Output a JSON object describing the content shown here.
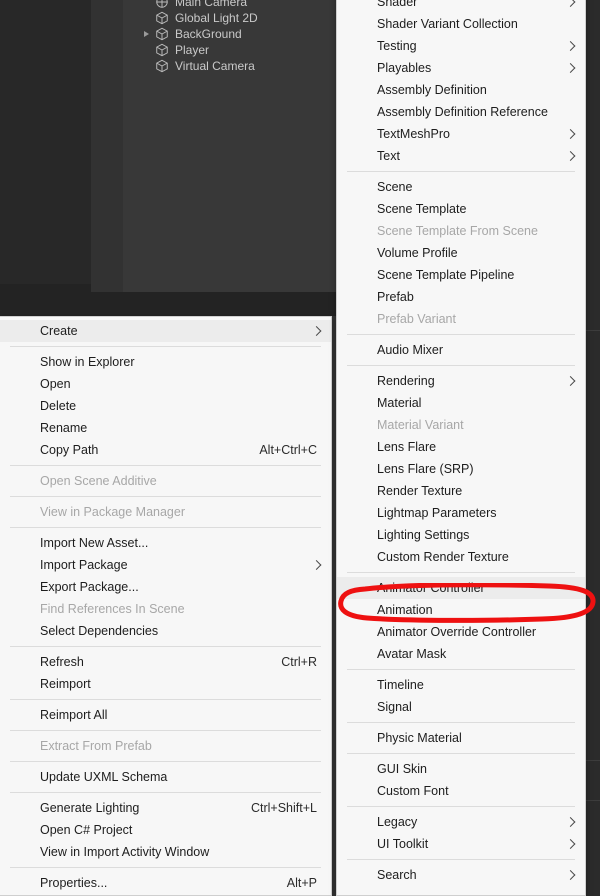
{
  "colors": {
    "annotation": "#ee1111",
    "menu_bg": "#f7f7f7",
    "menu_highlight": "#ececec",
    "editor_bg": "#383838",
    "disabled_text": "#a7a7a7"
  },
  "hierarchy": {
    "items": [
      {
        "label": "Main Camera",
        "icon": "camera-icon",
        "expandable": false,
        "partially_cut_off": true
      },
      {
        "label": "Global Light 2D",
        "icon": "prefab-cube-icon",
        "expandable": false
      },
      {
        "label": "BackGround",
        "icon": "prefab-cube-icon",
        "expandable": true
      },
      {
        "label": "Player",
        "icon": "prefab-cube-icon",
        "expandable": false
      },
      {
        "label": "Virtual Camera",
        "icon": "prefab-cube-icon",
        "expandable": false
      }
    ]
  },
  "context_menu": {
    "name": "project-window-context-menu",
    "items": [
      {
        "label": "Create",
        "submenu": true,
        "highlighted": true
      },
      {
        "separator": true
      },
      {
        "label": "Show in Explorer"
      },
      {
        "label": "Open"
      },
      {
        "label": "Delete"
      },
      {
        "label": "Rename"
      },
      {
        "label": "Copy Path",
        "shortcut": "Alt+Ctrl+C"
      },
      {
        "separator": true
      },
      {
        "label": "Open Scene Additive",
        "disabled": true
      },
      {
        "separator": true
      },
      {
        "label": "View in Package Manager",
        "disabled": true
      },
      {
        "separator": true
      },
      {
        "label": "Import New Asset..."
      },
      {
        "label": "Import Package",
        "submenu": true
      },
      {
        "label": "Export Package..."
      },
      {
        "label": "Find References In Scene",
        "disabled": true
      },
      {
        "label": "Select Dependencies"
      },
      {
        "separator": true
      },
      {
        "label": "Refresh",
        "shortcut": "Ctrl+R"
      },
      {
        "label": "Reimport"
      },
      {
        "separator": true
      },
      {
        "label": "Reimport All"
      },
      {
        "separator": true
      },
      {
        "label": "Extract From Prefab",
        "disabled": true
      },
      {
        "separator": true
      },
      {
        "label": "Update UXML Schema"
      },
      {
        "separator": true
      },
      {
        "label": "Generate Lighting",
        "shortcut": "Ctrl+Shift+L"
      },
      {
        "label": "Open C# Project"
      },
      {
        "label": "View in Import Activity Window"
      },
      {
        "separator": true
      },
      {
        "label": "Properties...",
        "shortcut": "Alt+P"
      }
    ]
  },
  "create_submenu": {
    "name": "create-submenu",
    "items": [
      {
        "label": "Shader",
        "submenu": true
      },
      {
        "label": "Shader Variant Collection"
      },
      {
        "label": "Testing",
        "submenu": true
      },
      {
        "label": "Playables",
        "submenu": true
      },
      {
        "label": "Assembly Definition"
      },
      {
        "label": "Assembly Definition Reference"
      },
      {
        "label": "TextMeshPro",
        "submenu": true
      },
      {
        "label": "Text",
        "submenu": true
      },
      {
        "separator": true
      },
      {
        "label": "Scene"
      },
      {
        "label": "Scene Template"
      },
      {
        "label": "Scene Template From Scene",
        "disabled": true
      },
      {
        "label": "Volume Profile"
      },
      {
        "label": "Scene Template Pipeline"
      },
      {
        "label": "Prefab"
      },
      {
        "label": "Prefab Variant",
        "disabled": true
      },
      {
        "separator": true
      },
      {
        "label": "Audio Mixer"
      },
      {
        "separator": true
      },
      {
        "label": "Rendering",
        "submenu": true
      },
      {
        "label": "Material"
      },
      {
        "label": "Material Variant",
        "disabled": true
      },
      {
        "label": "Lens Flare"
      },
      {
        "label": "Lens Flare (SRP)"
      },
      {
        "label": "Render Texture"
      },
      {
        "label": "Lightmap Parameters"
      },
      {
        "label": "Lighting Settings"
      },
      {
        "label": "Custom Render Texture"
      },
      {
        "separator": true
      },
      {
        "label": "Animator Controller",
        "highlighted": true,
        "annotated": true
      },
      {
        "label": "Animation"
      },
      {
        "label": "Animator Override Controller"
      },
      {
        "label": "Avatar Mask"
      },
      {
        "separator": true
      },
      {
        "label": "Timeline"
      },
      {
        "label": "Signal"
      },
      {
        "separator": true
      },
      {
        "label": "Physic Material"
      },
      {
        "separator": true
      },
      {
        "label": "GUI Skin"
      },
      {
        "label": "Custom Font"
      },
      {
        "separator": true
      },
      {
        "label": "Legacy",
        "submenu": true
      },
      {
        "label": "UI Toolkit",
        "submenu": true
      },
      {
        "separator": true
      },
      {
        "label": "Search",
        "submenu": true
      }
    ]
  },
  "annotation": {
    "shape": "ellipse",
    "target": "Animator Controller",
    "color": "#ee1111",
    "stroke_width": 5
  }
}
